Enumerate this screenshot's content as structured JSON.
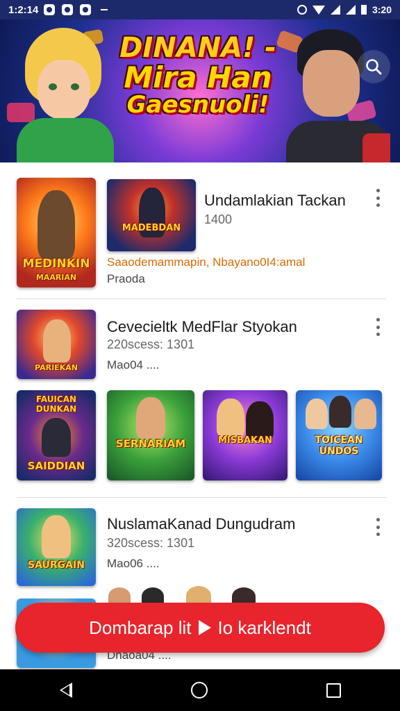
{
  "status_bar": {
    "time": "1:2:14",
    "battery_text": "3:20"
  },
  "banner": {
    "title_line1": "DINANA! -",
    "title_line2": "Mira Han",
    "title_line3": "Gaesnuoli!"
  },
  "list": [
    {
      "title": "Undamlakian Tackan",
      "meta": "1400",
      "subtitle_orange": "Saaodemammapin, Nbayano0I4:amal",
      "subtitle": "Praoda",
      "thumbs": [
        {
          "caption": "MEDINKIN",
          "subcaption": "MAARIAN"
        },
        {
          "caption": "MADEBDAN",
          "subcaption": ""
        }
      ]
    },
    {
      "title": "Cevecieltk MedFlar Styokan",
      "meta": "220scess: 1301",
      "subtitle": "Mao04 ....",
      "thumbs": [
        {
          "caption": "PARIEKAN"
        }
      ],
      "row_thumbs": [
        {
          "caption": "SAIDDIAN",
          "top": "FAUICAN DUNKAN"
        },
        {
          "caption": "SERNARIAM"
        },
        {
          "caption": "MISBAKAN"
        },
        {
          "caption": "TOICEAN UNDOS"
        }
      ]
    },
    {
      "title": "NuslamaKanad Dungudram",
      "meta": "320scess: 1301",
      "subtitle": "Mao06 ....",
      "partial_subtitle": "Dhaoa04 ....",
      "thumbs": [
        {
          "caption": "SAURGAIN"
        }
      ]
    }
  ],
  "cta": {
    "label_left": "Dombarap lit",
    "label_right": "Io karklendt"
  },
  "colors": {
    "accent": "#e8242c",
    "orange_text": "#e06a00",
    "banner_bg": "#1d2f8f"
  },
  "icons": {
    "search": "search-icon",
    "more": "more-vert-icon",
    "back": "back-icon",
    "home": "home-icon",
    "recents": "recents-icon"
  }
}
